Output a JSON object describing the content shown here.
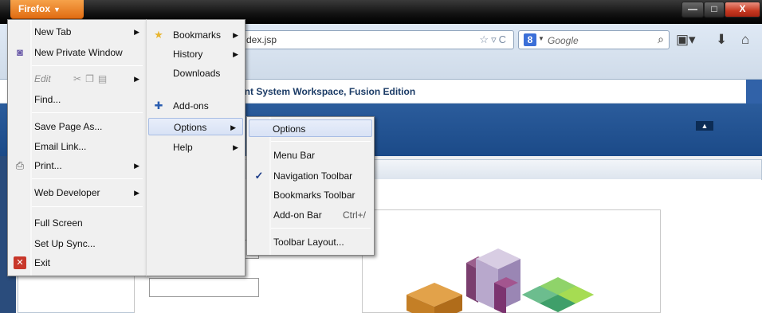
{
  "window": {
    "firefox_button": "Firefox",
    "min_label": "—",
    "max_label": "□",
    "close_label": "X"
  },
  "navigation": {
    "url": "dex.jsp",
    "search_engine": "Google",
    "page_title": "ent System Workspace, Fusion Edition"
  },
  "main_menu": {
    "items": [
      {
        "label": "New Tab"
      },
      {
        "label": "New Private Window"
      },
      {
        "label": "Edit"
      },
      {
        "label": "Find..."
      },
      {
        "label": "Save Page As..."
      },
      {
        "label": "Email Link..."
      },
      {
        "label": "Print..."
      },
      {
        "label": "Web Developer"
      },
      {
        "label": "Full Screen"
      },
      {
        "label": "Set Up Sync..."
      },
      {
        "label": "Exit"
      }
    ]
  },
  "right_menu": {
    "items": [
      {
        "label": "Bookmarks"
      },
      {
        "label": "History"
      },
      {
        "label": "Downloads"
      },
      {
        "label": "Add-ons"
      },
      {
        "label": "Options"
      },
      {
        "label": "Help"
      }
    ]
  },
  "options_submenu": {
    "items": [
      {
        "label": "Options"
      },
      {
        "label": "Menu Bar"
      },
      {
        "label": "Navigation Toolbar",
        "checked": true
      },
      {
        "label": "Bookmarks Toolbar"
      },
      {
        "label": "Add-on Bar",
        "shortcut": "Ctrl+/"
      },
      {
        "label": "Toolbar Layout..."
      }
    ]
  },
  "colors": {
    "firefox_orange": "#e27a1f",
    "header_blue": "#2b5c9c",
    "menu_background": "#f0f0f0"
  }
}
